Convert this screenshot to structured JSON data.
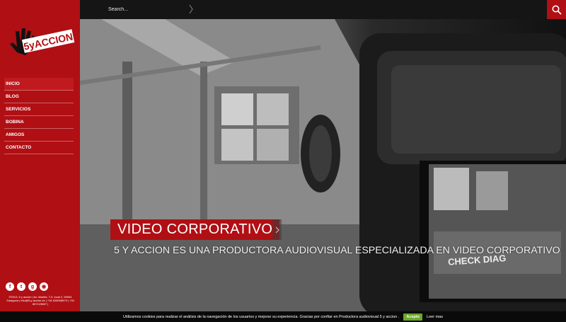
{
  "logo": {
    "text": "5yACCION"
  },
  "nav": {
    "items": [
      {
        "label": "INICIO"
      },
      {
        "label": "BLOG"
      },
      {
        "label": "SERVICIOS"
      },
      {
        "label": "BOBINA"
      },
      {
        "label": "AMIGOS"
      },
      {
        "label": "CONTACTO"
      }
    ],
    "active_index": 0
  },
  "social": [
    "facebook-icon",
    "twitter-icon",
    "google-plus-icon",
    "rss-icon"
  ],
  "address": "©2013, 5 y acción  |  Av. Madrid, 7-9, local 2, 50004 Zaragoza  |  info@5-y-accion.es  |  +34 628008879  |  +34 657123857  |",
  "search": {
    "placeholder": "Search..."
  },
  "hero": {
    "title": "VIDEO CORPORATIVO",
    "subtitle": "5 Y ACCION ES UNA PRODUCTORA AUDIOVISUAL ESPECIALIZADA EN VIDEO CORPORATIVO",
    "screen_text": "CHECK DIAG"
  },
  "cookie": {
    "text": "Utilizamos cookies para realizar el análisis de la navegación de los usuarios y mejorar su experiencia. Gracias por confiar en Productora audiovisual 5 y accion .",
    "accept_label": "Acepto",
    "more_label": "Leer mas"
  },
  "colors": {
    "brand_red": "#b00f14",
    "accept_green": "#6aa82a",
    "topbar": "#151515"
  }
}
